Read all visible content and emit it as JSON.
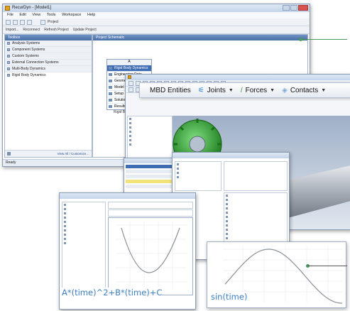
{
  "main_window": {
    "title": "RecurDyn - [Model1]",
    "menu": [
      "File",
      "Edit",
      "View",
      "Tools",
      "Workspace",
      "Help"
    ],
    "toolbar_tab": "Project",
    "toolbar_buttons": [
      "Import...",
      "Reconnect",
      "Refresh Project",
      "Update Project"
    ],
    "toolbox_title": "Toolbox",
    "toolbox_items": [
      "Analysis Systems",
      "Component Systems",
      "Custom Systems",
      "External Connection Systems",
      "Multi-Body Dynamics"
    ],
    "toolbox_plain_item": "Rigid Body Dynamics",
    "view_all_button": "View All / Customize...",
    "status": "Ready",
    "schematic_title": "Project Schematic"
  },
  "schematic": {
    "header": "A",
    "rows": [
      "Rigid Body Dynamics",
      "Engineering Data",
      "Geometry",
      "Model",
      "Setup",
      "Solution",
      "Results"
    ],
    "caption": "Rigid Body"
  },
  "mbd_toolbar": {
    "items": [
      {
        "label": "MBD Entities",
        "icon": "none"
      },
      {
        "label": "Joints",
        "icon": "joint-icon"
      },
      {
        "label": "Forces",
        "icon": "spring-icon"
      },
      {
        "label": "Contacts",
        "icon": "contact-icon"
      }
    ]
  },
  "formulas": {
    "left": "A*(time)^2+B*(time)+C",
    "right": "sin(time)"
  },
  "colors": {
    "accent_blue": "#3d7fc4",
    "callout_green": "#4a9a5a",
    "gear_green": "#2e9a2e"
  }
}
